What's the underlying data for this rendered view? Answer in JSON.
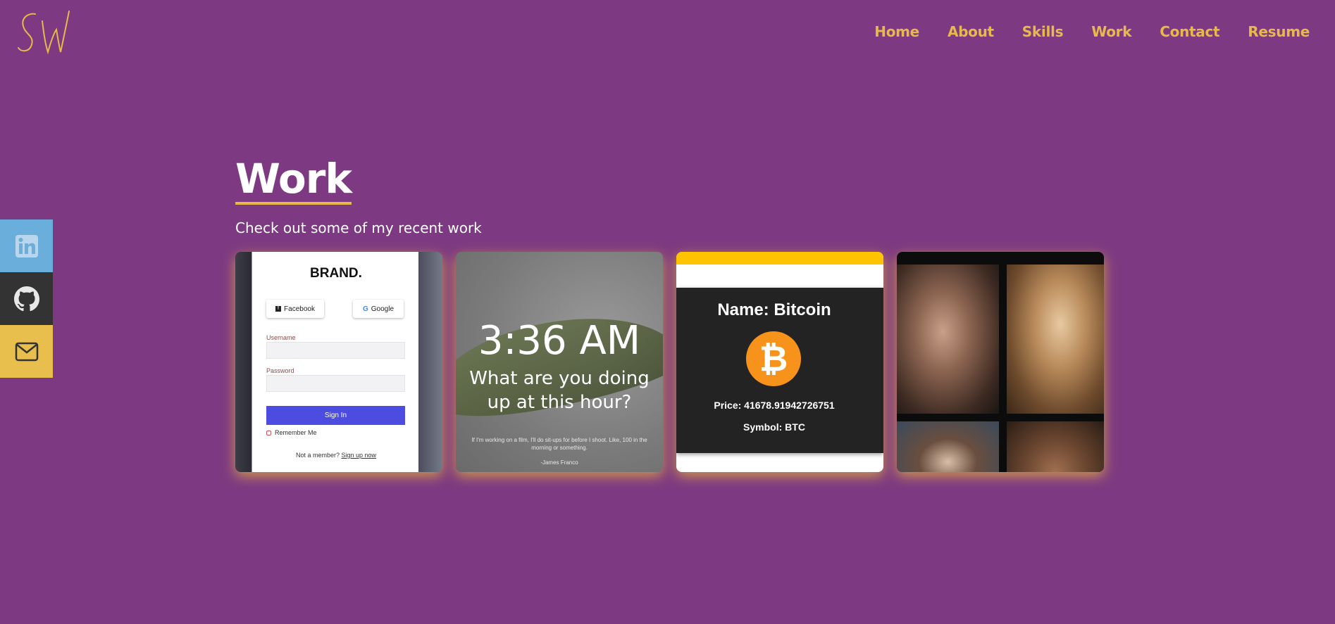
{
  "logo": {
    "text": "SW",
    "color": "#e6b94a"
  },
  "nav": {
    "items": [
      {
        "label": "Home"
      },
      {
        "label": "About"
      },
      {
        "label": "Skills"
      },
      {
        "label": "Work"
      },
      {
        "label": "Contact"
      },
      {
        "label": "Resume"
      }
    ]
  },
  "social": [
    {
      "icon": "linkedin-icon",
      "color": "#6aaedb"
    },
    {
      "icon": "github-icon",
      "color": "#333333"
    },
    {
      "icon": "mail-icon",
      "color": "#e8be4c"
    }
  ],
  "section": {
    "title": "Work",
    "subtitle": "Check out some of my recent work"
  },
  "cards": {
    "login": {
      "brand": "BRAND.",
      "facebook": "Facebook",
      "google": "Google",
      "username_label": "Username",
      "password_label": "Password",
      "signin": "Sign In",
      "remember": "Remember Me",
      "member_text": "Not a member?",
      "signup": "Sign up now"
    },
    "clock": {
      "time": "3:36 AM",
      "question": "What are you doing up at this hour?",
      "quote": "If I'm working on a film, I'll do sit-ups for before I shoot. Like, 100 in the morning or something.",
      "author": "-James Franco"
    },
    "crypto": {
      "name": "Name: Bitcoin",
      "price": "Price: 41678.91942726751",
      "symbol": "Symbol: BTC",
      "coin_glyph": "₿"
    },
    "gallery": {}
  },
  "colors": {
    "background": "#7d3a82",
    "accent": "#e6b94a"
  }
}
